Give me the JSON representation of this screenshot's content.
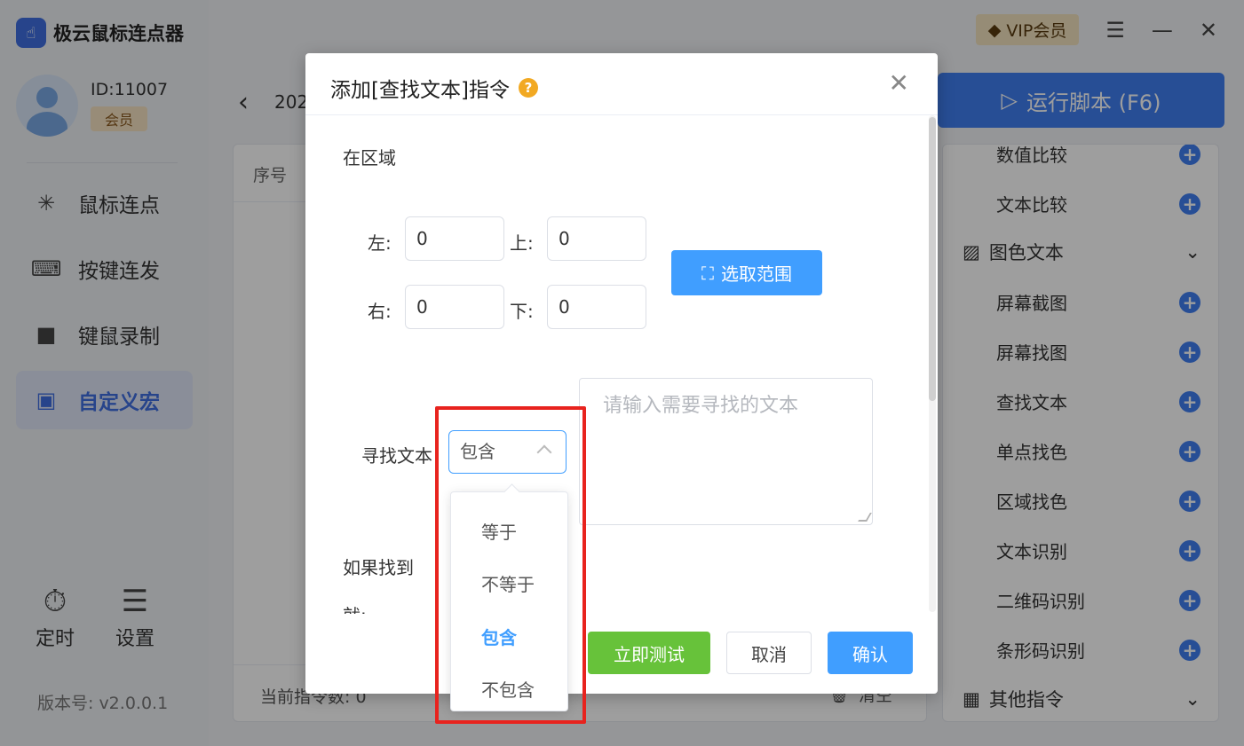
{
  "app": {
    "title": "极云鼠标连点器",
    "user_id": "ID:11007",
    "member_label": "会员",
    "vip_label": "VIP会员",
    "version": "版本号: v2.0.0.1"
  },
  "nav": [
    {
      "label": "鼠标连点",
      "icon": "click-cursor-icon"
    },
    {
      "label": "按键连发",
      "icon": "keyboard-icon"
    },
    {
      "label": "键鼠录制",
      "icon": "camera-icon"
    },
    {
      "label": "自定义宏",
      "icon": "macro-icon",
      "active": true
    }
  ],
  "tools": {
    "timer": "定时",
    "settings": "设置"
  },
  "main": {
    "title_partial": "202",
    "col_seq": "序号",
    "footer_count": "当前指令数: 0",
    "footer_clear": "清空"
  },
  "run_button": "运行脚本 (F6)",
  "commands": {
    "items_top": [
      "数值比较",
      "文本比较"
    ],
    "group_image_text": "图色文本",
    "items_image": [
      "屏幕截图",
      "屏幕找图",
      "查找文本",
      "单点找色",
      "区域找色",
      "文本识别",
      "二维码识别",
      "条形码识别"
    ],
    "group_other": "其他指令"
  },
  "dialog": {
    "title": "添加[查找文本]指令",
    "help": "?",
    "section_region": "在区域",
    "left_label": "左:",
    "left_value": "0",
    "top_label": "上:",
    "top_value": "0",
    "right_label": "右:",
    "right_value": "0",
    "bottom_label": "下:",
    "bottom_value": "0",
    "select_range": "选取范围",
    "find_text_label": "寻找文本",
    "match_mode": "包含",
    "text_placeholder": "请输入需要寻找的文本",
    "if_found": "如果找到",
    "then_partial": "就:",
    "btn_test": "立即测试",
    "btn_cancel": "取消",
    "btn_ok": "确认"
  },
  "dropdown": {
    "options": [
      "等于",
      "不等于",
      "包含",
      "不包含"
    ],
    "selected": "包含"
  },
  "colors": {
    "accent": "#409eff",
    "brand": "#3f6fe0",
    "test_green": "#67c23a",
    "highlight": "#e8231e"
  }
}
